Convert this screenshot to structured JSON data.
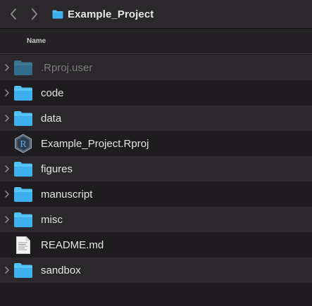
{
  "toolbar": {
    "path_title": "Example_Project"
  },
  "header": {
    "name_label": "Name"
  },
  "files": [
    {
      "name": ".Rproj.user",
      "kind": "folder",
      "expandable": true,
      "hidden": true
    },
    {
      "name": "code",
      "kind": "folder",
      "expandable": true,
      "hidden": false
    },
    {
      "name": "data",
      "kind": "folder",
      "expandable": true,
      "hidden": false
    },
    {
      "name": "Example_Project.Rproj",
      "kind": "rproj",
      "expandable": false,
      "hidden": false
    },
    {
      "name": "figures",
      "kind": "folder",
      "expandable": true,
      "hidden": false
    },
    {
      "name": "manuscript",
      "kind": "folder",
      "expandable": true,
      "hidden": false
    },
    {
      "name": "misc",
      "kind": "folder",
      "expandable": true,
      "hidden": false
    },
    {
      "name": "README.md",
      "kind": "markdown",
      "expandable": false,
      "hidden": false
    },
    {
      "name": "sandbox",
      "kind": "folder",
      "expandable": true,
      "hidden": false
    }
  ],
  "colors": {
    "folder_top": "#52c1f5",
    "folder_body": "#3fb0ef",
    "window_bg": "#1e1c1e",
    "row_alt_bg": "#2a282a"
  }
}
